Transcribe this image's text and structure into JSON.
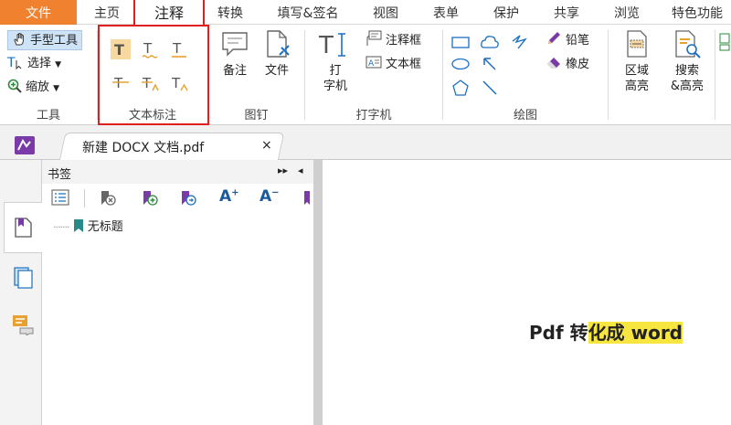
{
  "menubar": {
    "file": "文件",
    "items": [
      "主页",
      "注释",
      "转换",
      "填写&签名",
      "视图",
      "表单",
      "保护",
      "共享",
      "浏览",
      "特色功能"
    ],
    "active": "注释"
  },
  "ribbon": {
    "tools": {
      "hand": "手型工具",
      "select": "选择",
      "zoom": "缩放",
      "label": "工具"
    },
    "text_markup": {
      "label": "文本标注"
    },
    "pin": {
      "note": "备注",
      "file": "文件",
      "label": "图钉"
    },
    "typewriter": {
      "typewriter_line1": "打",
      "typewriter_line2": "字机",
      "callout": "注释框",
      "textbox": "文本框",
      "label": "打字机"
    },
    "drawing": {
      "pencil": "铅笔",
      "eraser": "橡皮",
      "label": "绘图"
    },
    "highlight": {
      "area_line1": "区域",
      "area_line2": "高亮",
      "search_line1": "搜索",
      "search_line2": "&高亮"
    }
  },
  "tab": {
    "title": "新建 DOCX 文档.pdf",
    "close": "×"
  },
  "bookmarks": {
    "header": "书签",
    "item": "无标题"
  },
  "document": {
    "text_plain": "Pdf 转",
    "text_highlighted": "化成 word"
  },
  "colors": {
    "accent": "#f0812e",
    "highlight_box": "#e02020",
    "text_highlight": "#f7e640",
    "icon_orange": "#e8a030",
    "bookmark_teal": "#2a8a8a"
  }
}
